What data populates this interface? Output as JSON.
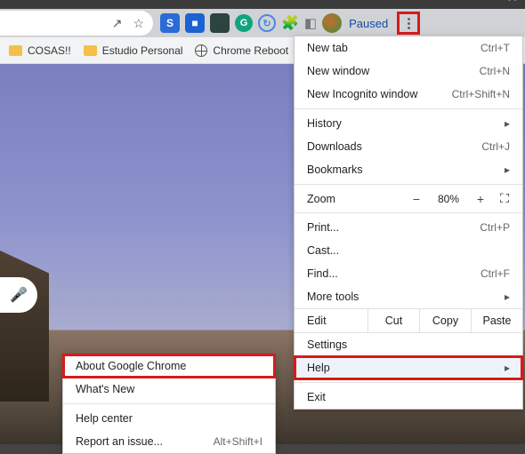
{
  "toolbar": {
    "paused_label": "Paused"
  },
  "bookmarks": [
    {
      "label": "COSAS!!",
      "icon": "folder"
    },
    {
      "label": "Estudio Personal",
      "icon": "folder"
    },
    {
      "label": "Chrome Reboot",
      "icon": "globe"
    }
  ],
  "menu": {
    "new_tab": {
      "label": "New tab",
      "shortcut": "Ctrl+T"
    },
    "new_window": {
      "label": "New window",
      "shortcut": "Ctrl+N"
    },
    "incognito": {
      "label": "New Incognito window",
      "shortcut": "Ctrl+Shift+N"
    },
    "history": {
      "label": "History"
    },
    "downloads": {
      "label": "Downloads",
      "shortcut": "Ctrl+J"
    },
    "bookmarks": {
      "label": "Bookmarks"
    },
    "zoom": {
      "label": "Zoom",
      "value": "80%",
      "minus": "−",
      "plus": "+"
    },
    "print": {
      "label": "Print...",
      "shortcut": "Ctrl+P"
    },
    "cast": {
      "label": "Cast..."
    },
    "find": {
      "label": "Find...",
      "shortcut": "Ctrl+F"
    },
    "more_tools": {
      "label": "More tools"
    },
    "edit": {
      "label": "Edit",
      "cut": "Cut",
      "copy": "Copy",
      "paste": "Paste"
    },
    "settings": {
      "label": "Settings"
    },
    "help": {
      "label": "Help"
    },
    "exit": {
      "label": "Exit"
    }
  },
  "help_submenu": {
    "about": {
      "label": "About Google Chrome"
    },
    "whats_new": {
      "label": "What's New"
    },
    "help_center": {
      "label": "Help center"
    },
    "report": {
      "label": "Report an issue...",
      "shortcut": "Alt+Shift+I"
    }
  }
}
